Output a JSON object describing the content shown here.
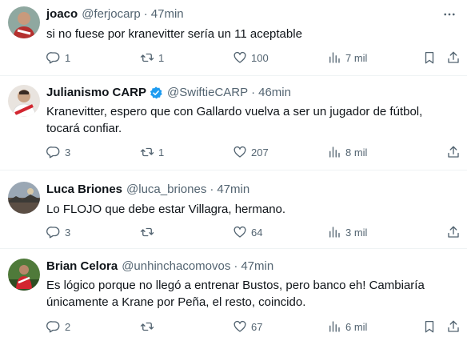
{
  "tweets": [
    {
      "name": "joaco",
      "handle": "@ferjocarp",
      "time": "47min",
      "verified": false,
      "text": "si no fuese por kranevitter sería un 11 aceptable",
      "replies": "1",
      "retweets": "1",
      "likes": "100",
      "views": "7 mil"
    },
    {
      "name": "Julianismo CARP",
      "handle": "@SwiftieCARP",
      "time": "46min",
      "verified": true,
      "text": "Kranevitter, espero que con Gallardo vuelva a ser un jugador de fútbol,\ntocará confiar.",
      "replies": "3",
      "retweets": "1",
      "likes": "207",
      "views": "8 mil"
    },
    {
      "name": "Luca Briones",
      "handle": "@luca_briones",
      "time": "47min",
      "verified": false,
      "text": "Lo FLOJO que debe estar Villagra, hermano.",
      "replies": "3",
      "retweets": "",
      "likes": "64",
      "views": "3 mil"
    },
    {
      "name": "Brian Celora",
      "handle": "@unhinchacomovos",
      "time": "47min",
      "verified": false,
      "text": "Es lógico porque no llegó a entrenar Bustos, pero banco eh! Cambiaría\núnicamente a Krane por Peña, el resto, coincido.",
      "replies": "2",
      "retweets": "",
      "likes": "67",
      "views": "6 mil"
    }
  ],
  "separator": "·",
  "colors": {
    "text": "#0f1419",
    "secondary": "#536471",
    "divider": "#eff3f4",
    "verified": "#1d9bf0"
  },
  "icons": [
    "reply-icon",
    "retweet-icon",
    "like-icon",
    "views-icon",
    "bookmark-icon",
    "share-icon",
    "more-icon",
    "verified-badge-icon"
  ]
}
